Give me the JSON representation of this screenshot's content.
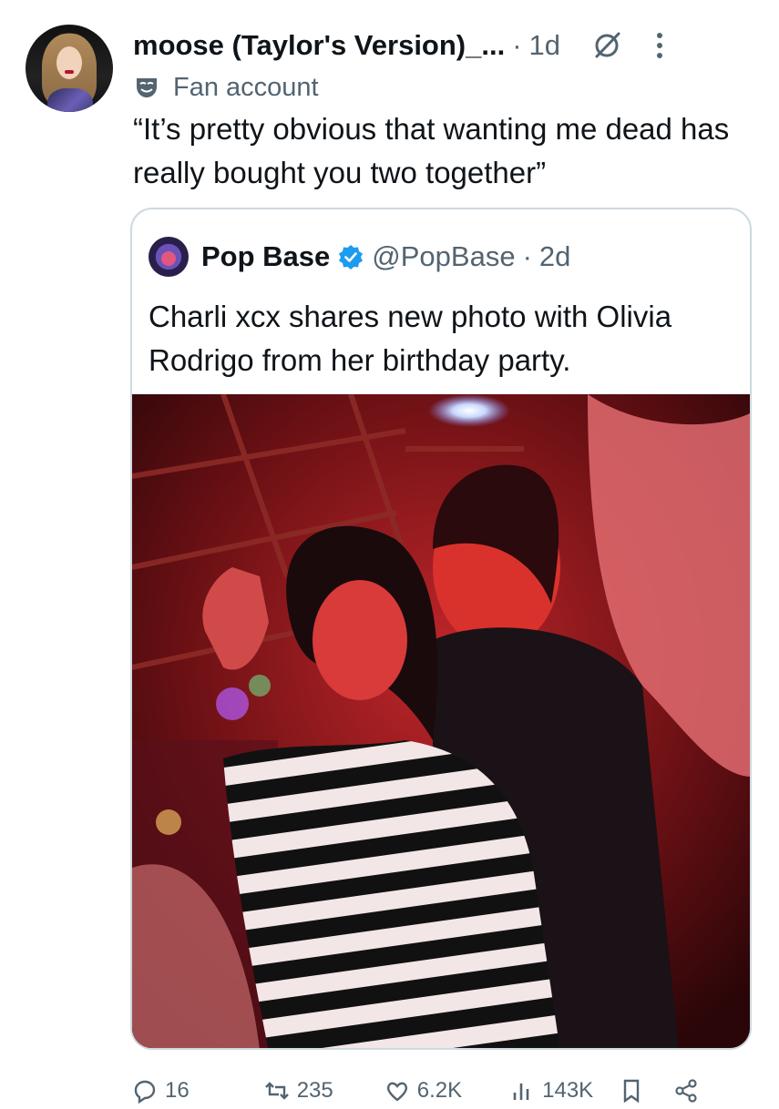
{
  "post": {
    "author": {
      "display_name": "moose (Taylor's Version)_...",
      "label": "Fan account",
      "label_icon": "theater-mask-icon",
      "avatar": "profile-photo"
    },
    "separator": "·",
    "time": "1d",
    "grok_icon": "grok-icon",
    "more_icon": "more-vertical-icon",
    "text": "“It’s pretty obvious that wanting me dead has really bought you two together”"
  },
  "quote": {
    "name": "Pop Base",
    "verified": true,
    "handle": "@PopBase",
    "separator": "·",
    "time": "2d",
    "text": "Charli xcx shares new photo with Olivia Rodrigo from her birthday party.",
    "media": "photo-two-women-red-lit-bar"
  },
  "actions": {
    "replies": "16",
    "reposts": "235",
    "likes": "6.2K",
    "views": "143K"
  },
  "colors": {
    "text": "#0f1419",
    "secondary": "#536471",
    "border": "#cfd9de",
    "verified": "#1d9bf0"
  }
}
